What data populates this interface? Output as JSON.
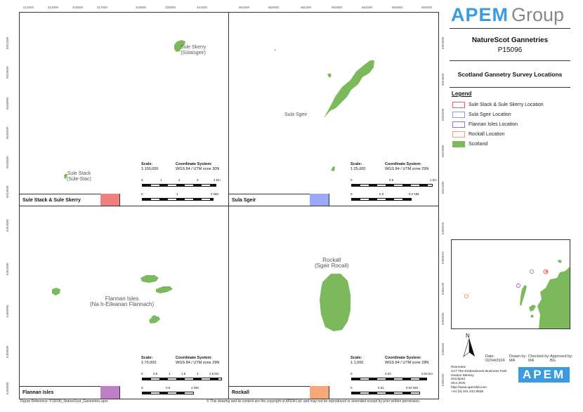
{
  "panels": {
    "sule": {
      "name": "Sule Stack & Sule Skerry",
      "label_skerry": [
        "Sule Skerry",
        "(Sùlaisgeir)"
      ],
      "label_stack": [
        "Sule Stack",
        "(Sùle-Stac)"
      ],
      "scale": "1:100,000",
      "coord_heading": "Coordinate System:",
      "coord": "WGS 84 / UTM zone 30N",
      "scale_heading": "Scale:",
      "km_labels": [
        "0",
        "1",
        "2",
        "3",
        "4 km"
      ],
      "nm_labels": [
        "0",
        "1",
        "2 NM"
      ],
      "color": "#f08080",
      "top_ticks": [
        "412500",
        "414000",
        "415500",
        "417000",
        "418500",
        "420000",
        "421500"
      ],
      "left_ticks": [
        "6551000",
        "6549500",
        "6548000",
        "6546500",
        "6545000",
        "6543500"
      ]
    },
    "sula": {
      "name": "Sula Sgeir",
      "label": [
        "Sula Sgeir"
      ],
      "scale": "1:25,000",
      "coord_heading": "Coordinate System:",
      "coord": "WGS 84 / UTM zone 29N",
      "scale_heading": "Scale:",
      "km_labels": [
        "0",
        "0.5",
        "1 km"
      ],
      "nm_labels": [
        "0",
        "0.2",
        "0.4 NM"
      ],
      "color": "#9aa8f5",
      "top_ticks": [
        "661600",
        "662000",
        "662400",
        "662800",
        "663200",
        "663600",
        "664000"
      ],
      "right_ticks": [
        "6554000",
        "6553600",
        "6553200",
        "6552800",
        "6552400"
      ]
    },
    "flannan": {
      "name": "Flannan Isles",
      "label": [
        "Flannan Isles",
        "(Na h-Eileanan Flannach)"
      ],
      "scale": "1:70,000",
      "coord_heading": "Coordinate System:",
      "coord": "WGS 84 / UTM zone 29N",
      "scale_heading": "Scale:",
      "km_labels": [
        "0",
        "0.5",
        "1",
        "1.5",
        "2",
        "2.5 km"
      ],
      "nm_labels": [
        "0",
        "0.5",
        "1 NM"
      ],
      "color": "#c080c8",
      "left_ticks": [
        "6464000",
        "6462000",
        "6460000",
        "6458000",
        "6456000"
      ]
    },
    "rockall": {
      "name": "Rockall",
      "label": [
        "Rockall",
        "(Sgeir Rocail)"
      ],
      "scale": "1:1,000",
      "coord_heading": "Coordinate System:",
      "coord": "WGS 84 / UTM zone 28N",
      "scale_heading": "Scale:",
      "km_labels": [
        "0",
        "0.02",
        "0.04 km"
      ],
      "nm_labels": [
        "0",
        "0.01",
        "0.02 NM"
      ],
      "color": "#f5a878",
      "right_ticks": [
        "6386525",
        "6386510",
        "6386495",
        "6386480",
        "6386465",
        "6386450"
      ]
    }
  },
  "sidebar": {
    "logo_a": "APEM",
    "logo_b": "Group",
    "title": "NatureScot Gannetries",
    "project": "P15096",
    "subtitle": "Scotland Gannetry Survey Locations",
    "legend_heading": "Legend",
    "legend": [
      {
        "label": "Sule Stack & Sule Skerry Location",
        "color": "#e86060",
        "type": "outline"
      },
      {
        "label": "Sula Sgeir Location",
        "color": "#8a9ae8",
        "type": "outline"
      },
      {
        "label": "Flannan Isles Location",
        "color": "#a070c8",
        "type": "outline"
      },
      {
        "label": "Rockall Location",
        "color": "#f0a070",
        "type": "outline"
      },
      {
        "label": "Scotland",
        "color": "#7cb95c",
        "type": "fill"
      }
    ],
    "north": "N",
    "info_headers": [
      "Date:",
      "Drawn by:",
      "Checked by:",
      "Approved by:"
    ],
    "info_values": [
      "02/04/2024",
      "MA",
      "MA",
      "BG"
    ],
    "address": [
      "Riverview",
      "A17 The Embankment Business Park",
      "Heaton Mersey",
      "Stockport",
      "SK4 3GN",
      "http://www.apemltd.com",
      "+44 (0) 161 442 8938"
    ],
    "logo_small": "APEM"
  },
  "footer": {
    "reference": "Figure Reference: P15096_NatureScot_Gannetries.aprx",
    "copyright": "© This drawing and its content are the copyright of APEM Ltd. and may not be reproduced or amended except by prior written permission."
  },
  "colors": {
    "land": "#7cb95c",
    "border": "#333333",
    "brand": "#3a9be0"
  }
}
